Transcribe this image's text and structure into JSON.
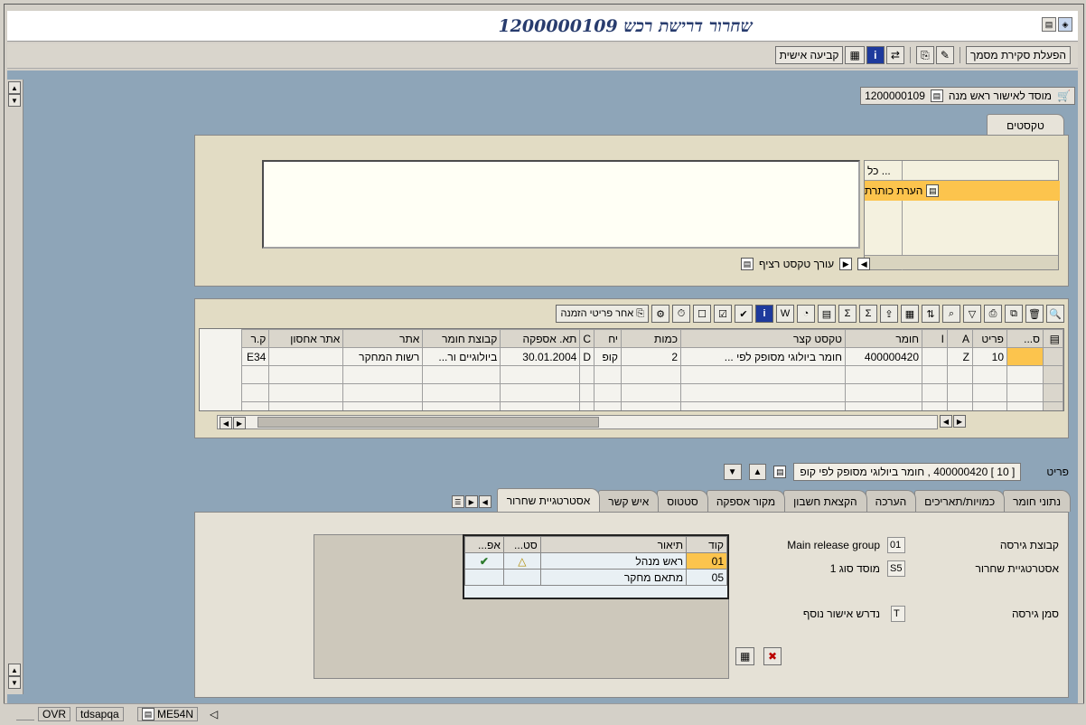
{
  "window": {
    "title": "שחרור דרישת רכש 1200000109"
  },
  "toolbar": {
    "doc_overview_label": "הפעלת סקירת מסמך",
    "personal_setting_label": "קביעה אישית"
  },
  "header": {
    "label": "מוסד לאישור ראש מנה",
    "doc_number": "1200000109"
  },
  "texts": {
    "tab_label": "טקסטים",
    "col_header": "כל ...",
    "selected_text_type": "הערת כותרת",
    "editor_label": "עורך טקסט רציף"
  },
  "grid": {
    "toolbar_button_label": "אחר פריטי הזמנה",
    "columns": [
      "ס...",
      "פריט",
      "A",
      "I",
      "חומר",
      "טקסט קצר",
      "כמות",
      "יח",
      "C",
      "תא. אספקה",
      "קבוצת חומר",
      "אתר",
      "אתר אחסון",
      "ק.ר"
    ],
    "rows": [
      {
        "status": "",
        "item": "10",
        "a": "Z",
        "i": "",
        "material": "400000420",
        "short_text": "חומר ביולוגי  מסופק לפי ...",
        "qty": "2",
        "unit": "קופ",
        "c": "D",
        "delivery": "30.01.2004",
        "mat_group": "ביולוגיים ור...",
        "plant": "רשות המחקר",
        "storage": "",
        "pg": "E34"
      }
    ]
  },
  "item": {
    "label": "פריט",
    "value": "[ 10 ] 400000420 , חומר ביולוגי  מסופק לפי קופ"
  },
  "tabs": [
    "נתוני חומר",
    "כמויות/תאריכים",
    "הערכה",
    "הקצאת חשבון",
    "מקור אספקה",
    "סטטוס",
    "איש קשר",
    "אסטרטגיית שחרור"
  ],
  "release": {
    "group_label": "קבוצת גירסה",
    "group_value": "01",
    "group_desc": "Main release group",
    "strategy_label": "אסטרטגיית שחרור",
    "strategy_value": "S5",
    "strategy_desc": "מוסד סוג 1",
    "indicator_label": "סמן גירסה",
    "indicator_value": "T",
    "indicator_desc": "נדרש אישור נוסף",
    "table_headers": [
      "קוד",
      "תיאור",
      "סט...",
      "אפ..."
    ],
    "table_rows": [
      {
        "code": "01",
        "desc": "ראש מנהל",
        "status": "warning",
        "approve": "approve"
      },
      {
        "code": "05",
        "desc": "מתאם מחקר",
        "status": "",
        "approve": ""
      }
    ]
  },
  "statusbar": {
    "transaction": "ME54N",
    "server": "tdsapqa",
    "mode": "OVR"
  },
  "colors": {
    "background": "#8ea5b8",
    "selection": "#fcc44d",
    "title": "#283c6e"
  }
}
